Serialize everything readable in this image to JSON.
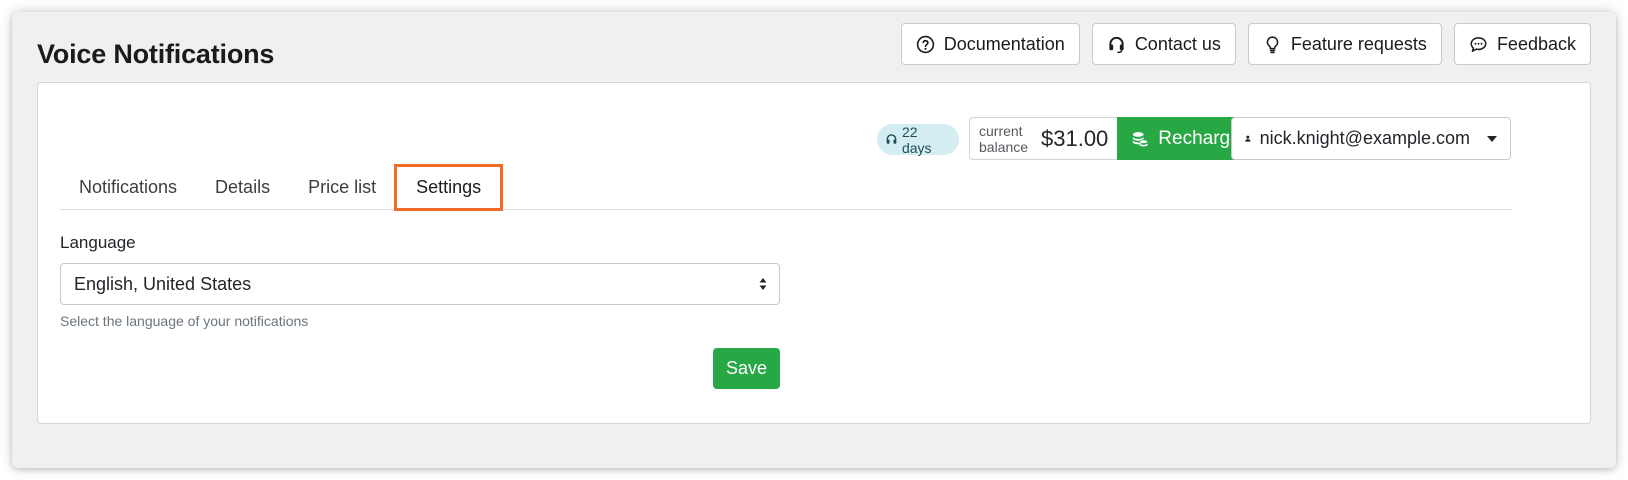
{
  "app": {
    "title": "Voice Notifications"
  },
  "top_links": [
    {
      "label": "Documentation",
      "icon": "question-circle-icon"
    },
    {
      "label": "Contact us",
      "icon": "headset-icon"
    },
    {
      "label": "Feature requests",
      "icon": "lightbulb-icon"
    },
    {
      "label": "Feedback",
      "icon": "chat-bubble-icon"
    }
  ],
  "account": {
    "days_badge": "22 days",
    "balance_label": "current balance",
    "balance_amount": "$31.00",
    "recharge_label": "Recharge",
    "user_email": "nick.knight@example.com"
  },
  "tabs": [
    {
      "label": "Notifications",
      "active": false
    },
    {
      "label": "Details",
      "active": false
    },
    {
      "label": "Price list",
      "active": false
    },
    {
      "label": "Settings",
      "active": true
    }
  ],
  "settings": {
    "language_label": "Language",
    "language_value": "English, United States",
    "language_help": "Select the language of your notifications",
    "save_label": "Save"
  },
  "colors": {
    "accent_green": "#28a745",
    "highlight_orange": "#f36b2b",
    "badge_bg": "#d4edf3"
  }
}
